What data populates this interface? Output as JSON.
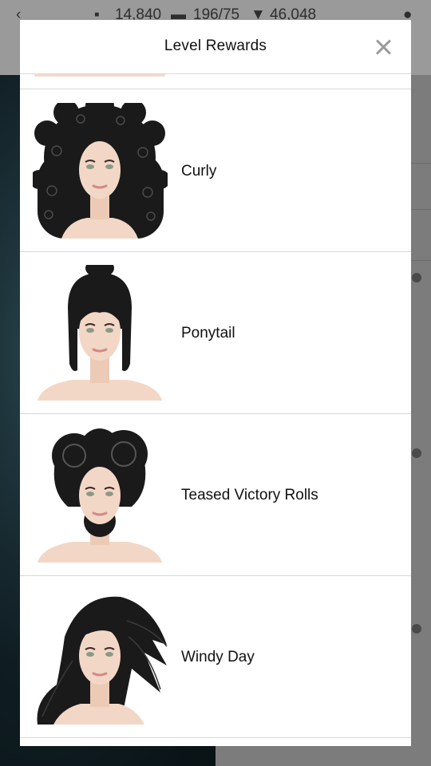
{
  "status_bar": {
    "cash": "14,840",
    "energy": "196/75",
    "diamonds": "46,048"
  },
  "modal": {
    "title": "Level Rewards"
  },
  "rewards": [
    {
      "label": "Curly",
      "hair": "curly"
    },
    {
      "label": "Ponytail",
      "hair": "ponytail"
    },
    {
      "label": "Teased Victory Rolls",
      "hair": "victory-rolls"
    },
    {
      "label": "Windy Day",
      "hair": "windy"
    }
  ],
  "colors": {
    "skin": "#f3d7c6",
    "hair": "#1a1a1a",
    "divider": "#d8d8d8",
    "close_icon": "#9b9b9b"
  }
}
